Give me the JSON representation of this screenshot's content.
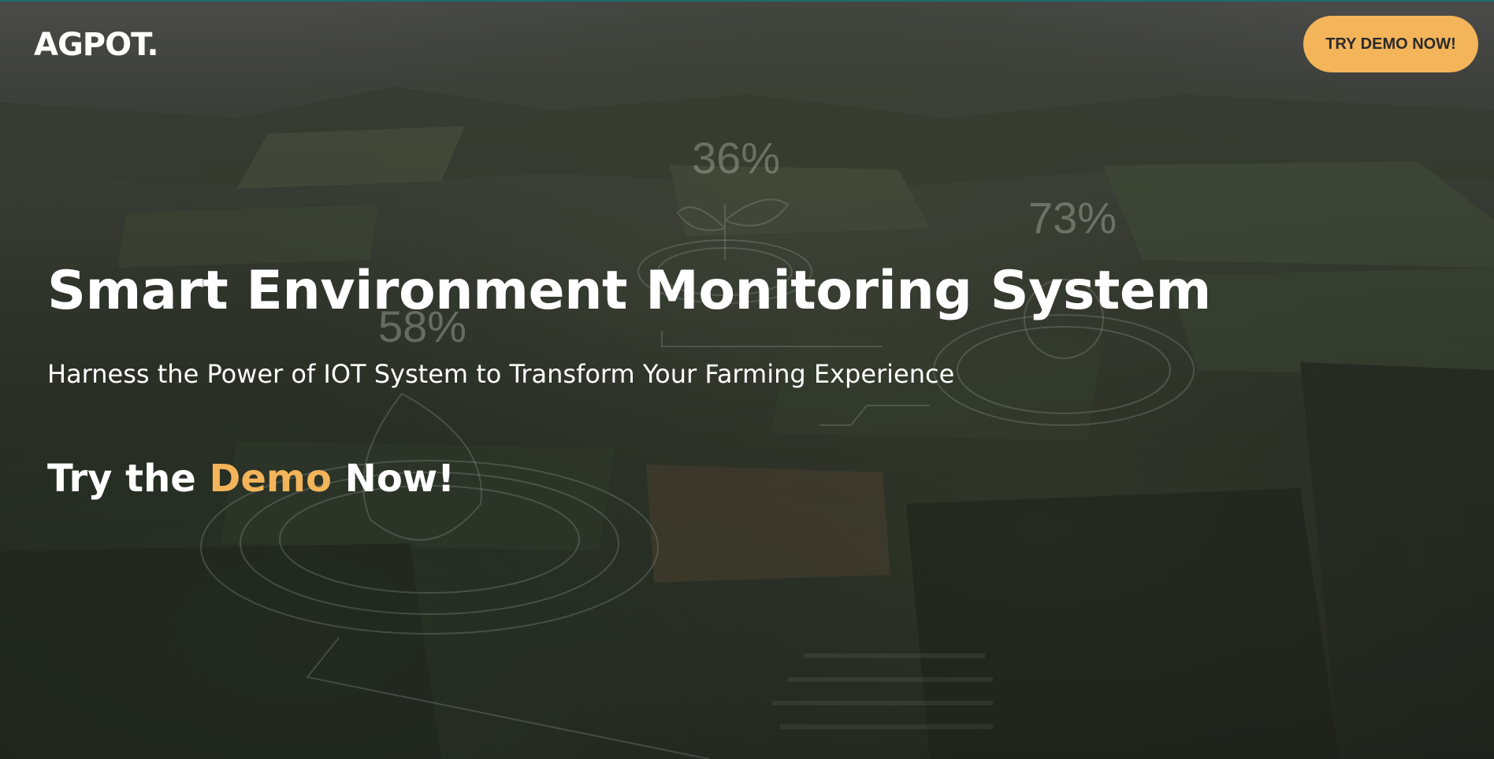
{
  "header": {
    "logo": "AGPOT.",
    "cta_button": "TRY DEMO NOW!"
  },
  "hero": {
    "title": "Smart Environment Monitoring System",
    "subtitle": "Harness the Power of IOT System to Transform Your Farming Experience",
    "cta_prefix": "Try the",
    "cta_accent": "Demo",
    "cta_suffix": "Now!"
  },
  "hud": {
    "plant_value": "36%",
    "sun_value": "73%",
    "water_value": "58%"
  },
  "colors": {
    "accent": "#f3b45a",
    "text": "#ffffff",
    "teal_line": "#1f8a8a"
  }
}
